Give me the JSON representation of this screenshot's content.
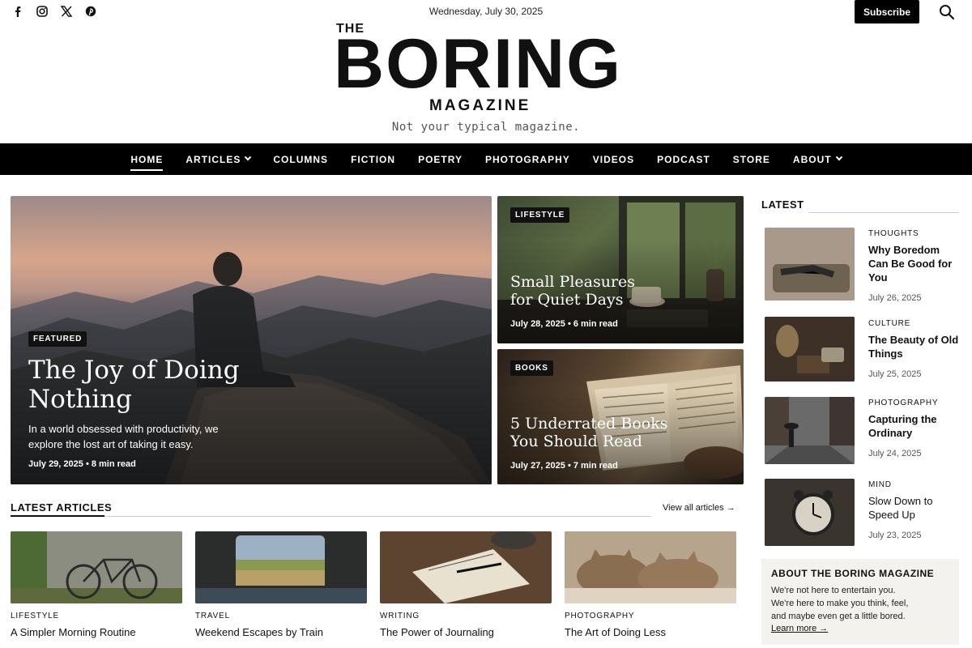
{
  "topbar": {
    "social": [
      "facebook-icon",
      "instagram-icon",
      "x-icon",
      "pinterest-icon"
    ],
    "date": "Wednesday, July 30, 2025",
    "subscribe_label": "Subscribe"
  },
  "masthead": {
    "the": "THE",
    "word": "BORING",
    "magazine": "MAGAZINE",
    "tagline": "Not your typical magazine."
  },
  "nav": {
    "items": [
      {
        "label": "HOME",
        "active": true
      },
      {
        "label": "ARTICLES",
        "dropdown": true
      },
      {
        "label": "COLUMNS"
      },
      {
        "label": "FICTION"
      },
      {
        "label": "POETRY"
      },
      {
        "label": "PHOTOGRAPHY"
      },
      {
        "label": "VIDEOS"
      },
      {
        "label": "PODCAST"
      },
      {
        "label": "STORE"
      },
      {
        "label": "ABOUT",
        "dropdown": true
      }
    ]
  },
  "hero": {
    "main": {
      "badge": "FEATURED",
      "title_l1": "The Joy of Doing",
      "title_l2": "Nothing",
      "desc_l1": "In a world obsessed with productivity, we",
      "desc_l2": "explore the lost art of taking it easy.",
      "meta": "July 29, 2025  •  8 min read"
    },
    "side1": {
      "badge": "LIFESTYLE",
      "title_l1": "Small Pleasures",
      "title_l2": "for Quiet Days",
      "meta": "July 28, 2025  •  6 min read"
    },
    "side2": {
      "badge": "BOOKS",
      "title_l1": "5 Underrated Books",
      "title_l2": "You Should Read",
      "meta": "July 27, 2025  •  7 min read"
    }
  },
  "latest_articles": {
    "heading": "LATEST ARTICLES",
    "view_all": "View all articles →",
    "items": [
      {
        "category": "LIFESTYLE",
        "title": "A Simpler Morning Routine"
      },
      {
        "category": "TRAVEL",
        "title": "Weekend Escapes by Train"
      },
      {
        "category": "WRITING",
        "title": "The Power of Journaling"
      },
      {
        "category": "PHOTOGRAPHY",
        "title": "The Art of Doing Less"
      }
    ]
  },
  "sidebar": {
    "heading": "LATEST",
    "items": [
      {
        "category": "THOUGHTS",
        "title": "Why Boredom Can Be Good for You",
        "date": "July 26, 2025"
      },
      {
        "category": "CULTURE",
        "title": "The Beauty of Old Things",
        "date": "July 25, 2025"
      },
      {
        "category": "PHOTOGRAPHY",
        "title": "Capturing the Ordinary",
        "date": "July 24, 2025"
      },
      {
        "category": "MIND",
        "title": "Slow Down to Speed Up",
        "date": "July 23, 2025"
      }
    ],
    "about": {
      "title": "ABOUT THE BORING MAGAZINE",
      "line1": "We're not here to entertain you.",
      "line2": "We're here to make you think, feel,",
      "line3": "and maybe even get a little bored.",
      "link": "Learn more →"
    }
  }
}
